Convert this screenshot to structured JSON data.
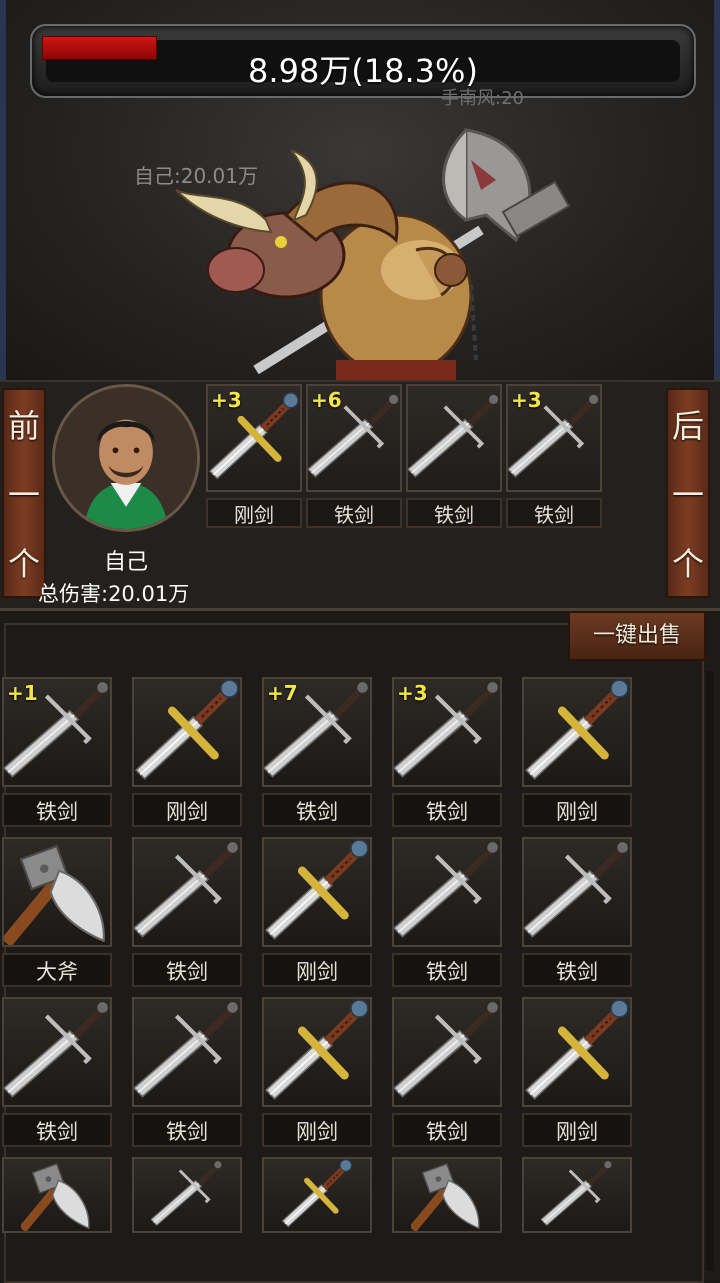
{
  "boss": {
    "hp_text": "8.98万(18.3%)",
    "hp_fraction": 0.183,
    "player_tag": "手南风:20",
    "self_damage_tag": "自己:20.01万",
    "figure_icon": "minotaur-boss-icon"
  },
  "player": {
    "prev_label": [
      "前",
      "一",
      "个"
    ],
    "next_label": [
      "后",
      "一",
      "个"
    ],
    "name": "自己",
    "total_damage": "总伤害:20.01万",
    "equipment": [
      {
        "level": "+3",
        "name": "刚剑",
        "icon": "steel-sword-icon"
      },
      {
        "level": "+6",
        "name": "铁剑",
        "icon": "iron-sword-icon"
      },
      {
        "level": "",
        "name": "铁剑",
        "icon": "iron-sword-icon"
      },
      {
        "level": "+3",
        "name": "铁剑",
        "icon": "iron-sword-icon"
      }
    ]
  },
  "inventory": {
    "sell_all_label": "一键出售",
    "items": [
      {
        "level": "+1",
        "name": "铁剑",
        "icon": "iron-sword-icon"
      },
      {
        "level": "",
        "name": "刚剑",
        "icon": "steel-sword-icon"
      },
      {
        "level": "+7",
        "name": "铁剑",
        "icon": "iron-sword-icon"
      },
      {
        "level": "+3",
        "name": "铁剑",
        "icon": "iron-sword-icon"
      },
      {
        "level": "",
        "name": "刚剑",
        "icon": "steel-sword-icon"
      },
      {
        "level": "",
        "name": "大斧",
        "icon": "great-axe-icon"
      },
      {
        "level": "",
        "name": "铁剑",
        "icon": "iron-sword-icon"
      },
      {
        "level": "",
        "name": "刚剑",
        "icon": "steel-sword-icon"
      },
      {
        "level": "",
        "name": "铁剑",
        "icon": "iron-sword-icon"
      },
      {
        "level": "",
        "name": "铁剑",
        "icon": "iron-sword-icon"
      },
      {
        "level": "",
        "name": "铁剑",
        "icon": "iron-sword-icon"
      },
      {
        "level": "",
        "name": "铁剑",
        "icon": "iron-sword-icon"
      },
      {
        "level": "",
        "name": "刚剑",
        "icon": "steel-sword-icon"
      },
      {
        "level": "",
        "name": "铁剑",
        "icon": "iron-sword-icon"
      },
      {
        "level": "",
        "name": "刚剑",
        "icon": "steel-sword-icon"
      },
      {
        "level": "",
        "name": "",
        "icon": "great-axe-icon"
      },
      {
        "level": "",
        "name": "",
        "icon": "iron-sword-icon"
      },
      {
        "level": "",
        "name": "",
        "icon": "steel-sword-icon"
      },
      {
        "level": "",
        "name": "",
        "icon": "great-axe-icon"
      },
      {
        "level": "",
        "name": "",
        "icon": "iron-sword-icon"
      }
    ]
  },
  "colors": {
    "hp_red": "#c41010",
    "level_yellow": "#f1e54a",
    "button_brown": "#6b3a22"
  }
}
